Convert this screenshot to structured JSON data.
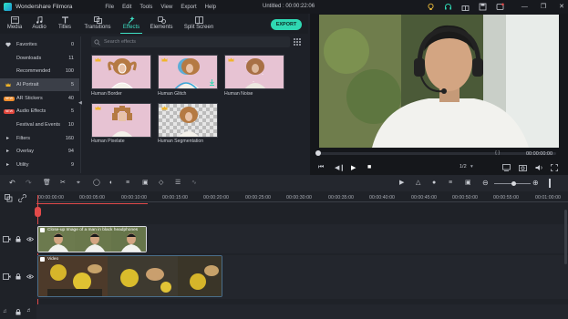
{
  "app": {
    "name": "Wondershare Filmora",
    "title": "Untitled : 00:00:22:06"
  },
  "menu": [
    "File",
    "Edit",
    "Tools",
    "View",
    "Export",
    "Help"
  ],
  "tabs": [
    {
      "label": "Media",
      "icon": "media-icon"
    },
    {
      "label": "Audio",
      "icon": "audio-icon"
    },
    {
      "label": "Titles",
      "icon": "titles-icon"
    },
    {
      "label": "Transitions",
      "icon": "transitions-icon"
    },
    {
      "label": "Effects",
      "icon": "effects-icon",
      "active": true
    },
    {
      "label": "Elements",
      "icon": "elements-icon"
    },
    {
      "label": "Split Screen",
      "icon": "split-screen-icon"
    }
  ],
  "export_label": "EXPORT",
  "sidebar": [
    {
      "label": "Favorites",
      "count": "0",
      "icon": "heart-icon"
    },
    {
      "label": "Downloads",
      "count": "11"
    },
    {
      "label": "Recommended",
      "count": "100"
    },
    {
      "label": "AI Portrait",
      "count": "5",
      "icon": "crown-icon",
      "active": true
    },
    {
      "label": "AR Stickers",
      "count": "40",
      "badge": "NEW"
    },
    {
      "label": "Audio Effects",
      "count": "5",
      "badge": "NEW"
    },
    {
      "label": "Festival and Events",
      "count": "10"
    },
    {
      "label": "Filters",
      "count": "160",
      "icon": "chevron-right-icon"
    },
    {
      "label": "Overlay",
      "count": "94",
      "icon": "chevron-right-icon"
    },
    {
      "label": "Utility",
      "count": "9",
      "icon": "chevron-right-icon"
    }
  ],
  "search": {
    "placeholder": "Search effects"
  },
  "effects": [
    {
      "label": "Human Border"
    },
    {
      "label": "Human Glitch"
    },
    {
      "label": "Human Noise"
    },
    {
      "label": "Human Pixelate"
    },
    {
      "label": "Human Segmentation"
    }
  ],
  "player": {
    "timecode": "00:00:00:00",
    "zoom": "1/2",
    "braces": "{   }"
  },
  "ruler": [
    "00:00:00:00",
    "00:00:05:00",
    "00:00:10:00",
    "00:00:15:00",
    "00:00:20:00",
    "00:00:25:00",
    "00:00:30:00",
    "00:00:35:00",
    "00:00:40:00",
    "00:00:45:00",
    "00:00:50:00",
    "00:00:55:00",
    "00:01:00:00"
  ],
  "clips": [
    {
      "label": "Close-up Image of a man in black headphones"
    },
    {
      "label": "Video"
    }
  ],
  "colors": {
    "accent": "#2fd8b3",
    "playhead": "#e24a4a",
    "clip_border": "#d7d9de"
  }
}
